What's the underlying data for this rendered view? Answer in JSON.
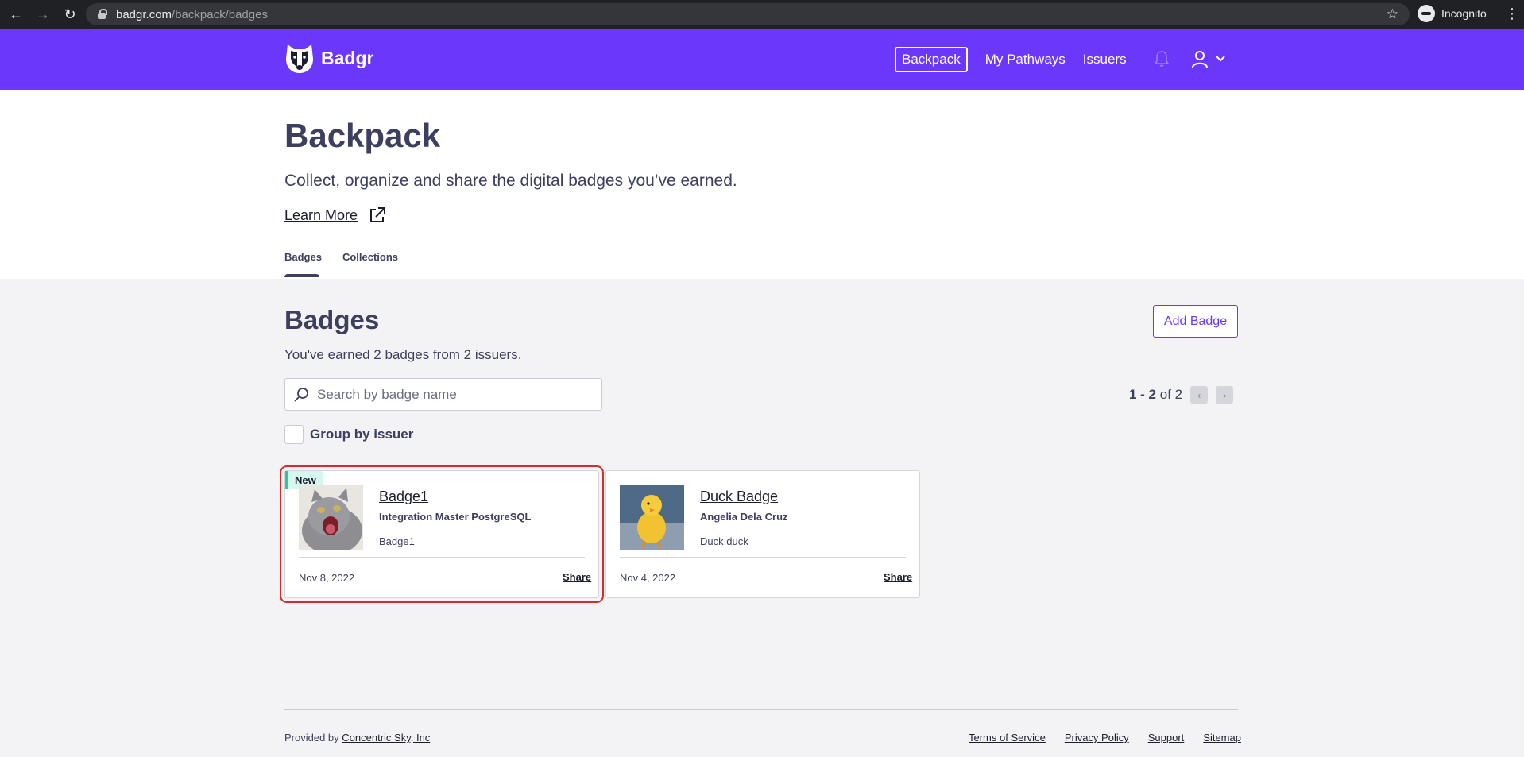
{
  "browser": {
    "url_host": "badgr.com",
    "url_path": "/backpack/badges",
    "profile_label": "Incognito"
  },
  "header": {
    "logo_text": "Badgr",
    "nav": [
      {
        "label": "Backpack",
        "active": true
      },
      {
        "label": "My Pathways",
        "active": false
      },
      {
        "label": "Issuers",
        "active": false
      }
    ],
    "icons": [
      "bell-icon",
      "user-icon",
      "chevron-down-icon"
    ]
  },
  "hero": {
    "title": "Backpack",
    "subtitle": "Collect, organize and share the digital badges you’ve earned.",
    "learn_more": "Learn More",
    "tabs": [
      {
        "label": "Badges",
        "active": true
      },
      {
        "label": "Collections",
        "active": false
      }
    ]
  },
  "badges_section": {
    "title": "Badges",
    "summary": "You've earned 2 badges from 2 issuers.",
    "add_button": "Add Badge",
    "search_placeholder": "Search by badge name",
    "search_value": "",
    "pager_range": "1 - 2",
    "pager_of": "of 2",
    "group_by_label": "Group by issuer",
    "group_by_checked": false
  },
  "cards": [
    {
      "new_label": "New",
      "title": "Badge1",
      "issuer": "Integration Master PostgreSQL",
      "description": "Badge1",
      "date": "Nov 8, 2022",
      "share": "Share",
      "thumb": "cat-photo"
    },
    {
      "title": "Duck Badge",
      "issuer": "Angelia Dela Cruz",
      "description": "Duck duck",
      "date": "Nov 4, 2022",
      "share": "Share",
      "thumb": "duckling-photo"
    }
  ],
  "footer": {
    "provided_by": "Provided by",
    "provider": "Concentric Sky, Inc",
    "links": [
      "Terms of Service",
      "Privacy Policy",
      "Support",
      "Sitemap"
    ]
  },
  "colors": {
    "brand": "#6b38fb",
    "text": "#3d3f5e",
    "new_accent": "#27c89c",
    "selection": "#d52b2b"
  }
}
